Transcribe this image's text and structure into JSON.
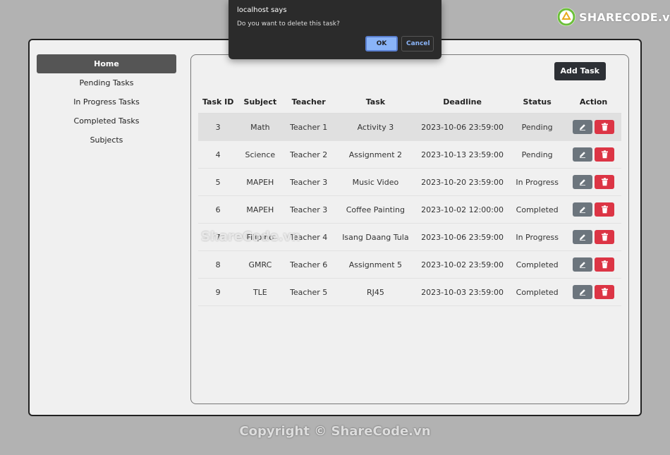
{
  "sidebar": {
    "items": [
      {
        "label": "Home",
        "active": true
      },
      {
        "label": "Pending Tasks"
      },
      {
        "label": "In Progress Tasks"
      },
      {
        "label": "Completed Tasks"
      },
      {
        "label": "Subjects"
      }
    ]
  },
  "main": {
    "add_task_label": "Add Task",
    "columns": [
      "Task ID",
      "Subject",
      "Teacher",
      "Task",
      "Deadline",
      "Status",
      "Action"
    ],
    "rows": [
      {
        "id": "3",
        "subject": "Math",
        "teacher": "Teacher 1",
        "task": "Activity 3",
        "deadline": "2023-10-06 23:59:00",
        "status": "Pending"
      },
      {
        "id": "4",
        "subject": "Science",
        "teacher": "Teacher 2",
        "task": "Assignment 2",
        "deadline": "2023-10-13 23:59:00",
        "status": "Pending"
      },
      {
        "id": "5",
        "subject": "MAPEH",
        "teacher": "Teacher 3",
        "task": "Music Video",
        "deadline": "2023-10-20 23:59:00",
        "status": "In Progress"
      },
      {
        "id": "6",
        "subject": "MAPEH",
        "teacher": "Teacher 3",
        "task": "Coffee Painting",
        "deadline": "2023-10-02 12:00:00",
        "status": "Completed"
      },
      {
        "id": "7",
        "subject": "Filipino",
        "teacher": "Teacher 4",
        "task": "Isang Daang Tula",
        "deadline": "2023-10-06 23:59:00",
        "status": "In Progress"
      },
      {
        "id": "8",
        "subject": "GMRC",
        "teacher": "Teacher 6",
        "task": "Assignment 5",
        "deadline": "2023-10-02 23:59:00",
        "status": "Completed"
      },
      {
        "id": "9",
        "subject": "TLE",
        "teacher": "Teacher 5",
        "task": "RJ45",
        "deadline": "2023-10-03 23:59:00",
        "status": "Completed"
      }
    ],
    "icons": {
      "edit": "pencil-icon",
      "delete": "trash-icon"
    }
  },
  "dialog": {
    "title": "localhost says",
    "message": "Do you want to delete this task?",
    "ok_label": "OK",
    "cancel_label": "Cancel"
  },
  "watermarks": {
    "logo": "SHARECODE.vn",
    "middle": "ShareCode.vn",
    "bottom": "Copyright © ShareCode.vn"
  },
  "colors": {
    "edit_button": "#6c757d",
    "delete_button": "#dc3545",
    "active_nav": "#555555",
    "dialog_ok": "#8ab4f8"
  }
}
